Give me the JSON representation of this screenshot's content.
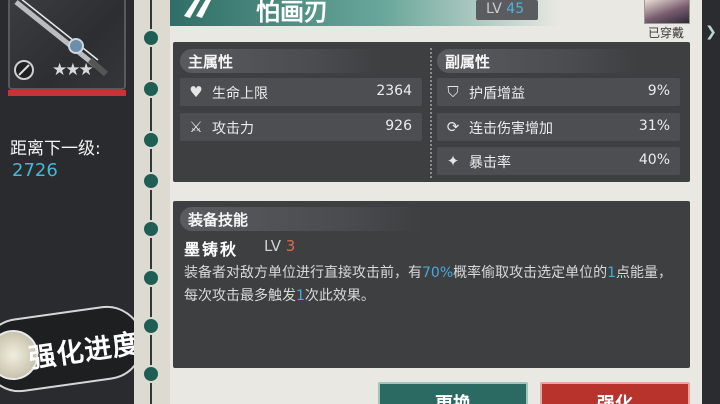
{
  "weapon": {
    "title": "怕画刃",
    "level_label": "LV",
    "level_value": "45",
    "stars": "★★★",
    "equipped_label": "已穿戴"
  },
  "left_panel": {
    "next_level_label": "距离下一级:",
    "next_level_value": "2726",
    "enhance_button": "强化进度"
  },
  "main_stats": {
    "header": "主属性",
    "items": [
      {
        "icon": "heart-icon",
        "name": "生命上限",
        "value": "2364"
      },
      {
        "icon": "crossed-swords-icon",
        "name": "攻击力",
        "value": "926"
      }
    ]
  },
  "sub_stats": {
    "header": "副属性",
    "items": [
      {
        "icon": "shield-icon",
        "name": "护盾增益",
        "value": "9%"
      },
      {
        "icon": "combo-icon",
        "name": "连击伤害增加",
        "value": "31%"
      },
      {
        "icon": "crit-icon",
        "name": "暴击率",
        "value": "40%"
      }
    ]
  },
  "skill": {
    "header": "装备技能",
    "name": "墨铸秋",
    "level_label": "LV",
    "level_value": "3",
    "desc_part1": "装备者对敌方单位进行直接攻击前，有",
    "desc_hl1": "70%",
    "desc_part2": "概率偷取攻击选定单位的",
    "desc_hl2": "1",
    "desc_part3": "点能量，每次攻击最多触发",
    "desc_hl3": "1",
    "desc_part4": "次此效果。"
  },
  "buttons": {
    "replace": "更换",
    "enhance": "强化"
  },
  "colors": {
    "accent_teal": "#2b6a62",
    "accent_red": "#b7332c",
    "highlight_blue": "#4aa8de"
  }
}
